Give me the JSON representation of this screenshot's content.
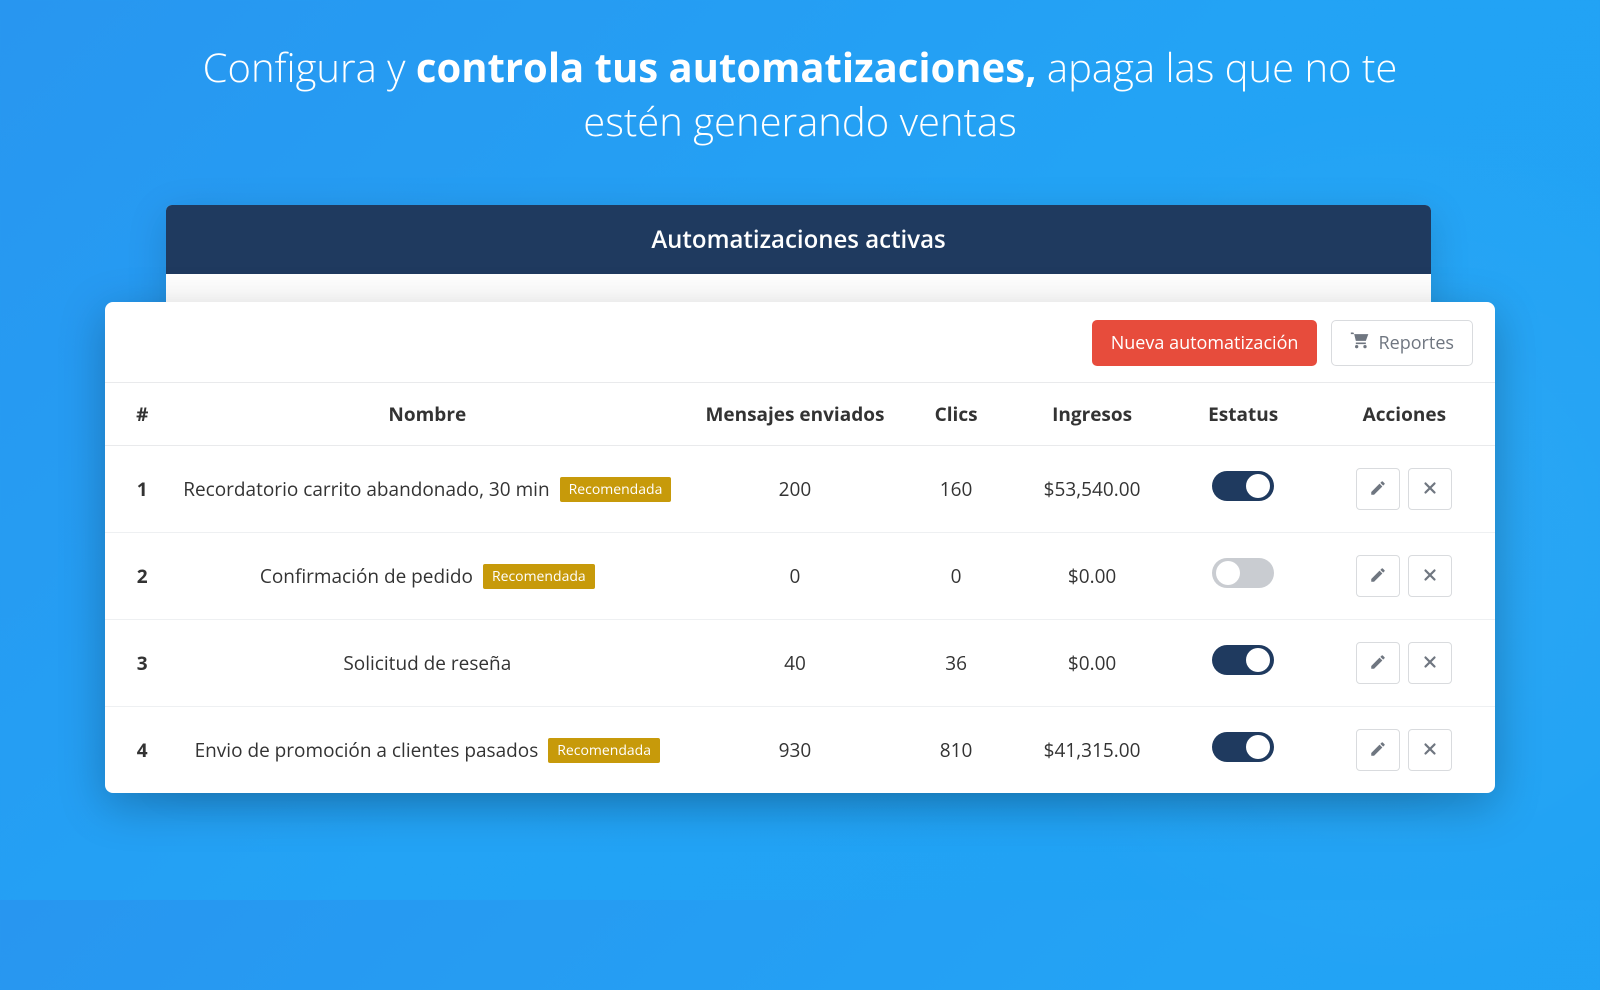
{
  "hero": {
    "pre": "Configura y ",
    "bold": "controla tus automatizaciones,",
    "post": " apaga las que no te estén generando ventas"
  },
  "panel": {
    "title": "Automatizaciones activas"
  },
  "toolbar": {
    "new_label": "Nueva automatización",
    "reports_label": "Reportes"
  },
  "badge_label": "Recomendada",
  "columns": {
    "index": "#",
    "name": "Nombre",
    "messages": "Mensajes enviados",
    "clicks": "Clics",
    "income": "Ingresos",
    "status": "Estatus",
    "actions": "Acciones"
  },
  "rows": [
    {
      "idx": "1",
      "name": "Recordatorio carrito abandonado, 30 min",
      "recommended": true,
      "messages": "200",
      "clicks": "160",
      "income": "$53,540.00",
      "enabled": true
    },
    {
      "idx": "2",
      "name": "Confirmación de pedido",
      "recommended": true,
      "messages": "0",
      "clicks": "0",
      "income": "$0.00",
      "enabled": false
    },
    {
      "idx": "3",
      "name": "Solicitud de reseña",
      "recommended": false,
      "messages": "40",
      "clicks": "36",
      "income": "$0.00",
      "enabled": true
    },
    {
      "idx": "4",
      "name": "Envio de promoción a clientes pasados",
      "recommended": true,
      "messages": "930",
      "clicks": "810",
      "income": "$41,315.00",
      "enabled": true
    }
  ]
}
